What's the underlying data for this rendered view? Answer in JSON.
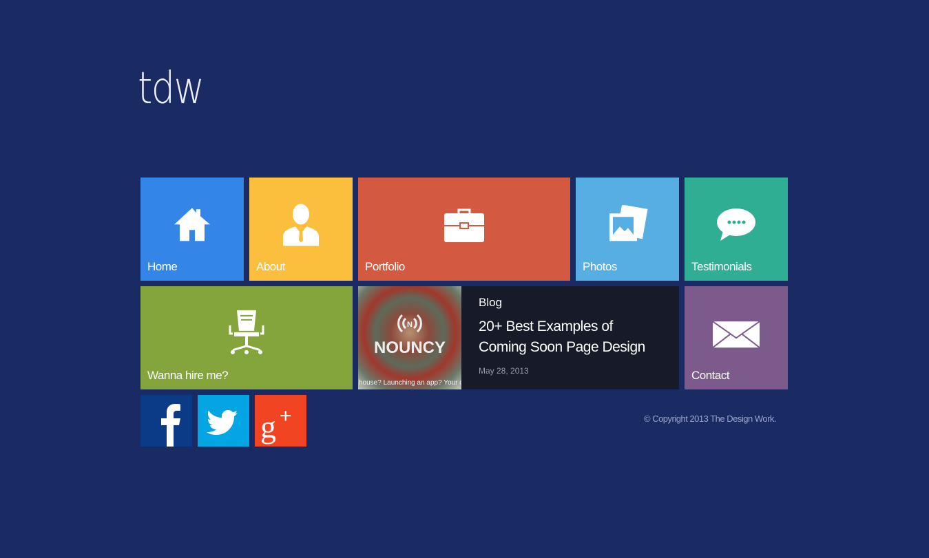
{
  "logo": "tdw",
  "tiles": {
    "home": "Home",
    "about": "About",
    "portfolio": "Portfolio",
    "photos": "Photos",
    "testimonials": "Testimonials",
    "hire": "Wanna hire me?",
    "contact": "Contact"
  },
  "blog": {
    "heading": "Blog",
    "title": "20+ Best Examples of Coming Soon Page Design",
    "date": "May 28, 2013",
    "image_brand": "NOUNCY",
    "image_caption": "house? Launching an app? Your dog"
  },
  "social": {
    "facebook": "f",
    "twitter": "twitter-bird",
    "googleplus": "g+"
  },
  "copyright": "© Copyright 2013 The Design Work.",
  "colors": {
    "background": "#1a2a63",
    "home": "#3386e8",
    "about": "#fbbe3d",
    "portfolio": "#d35940",
    "photos": "#57aee3",
    "testimonials": "#30ae94",
    "hire": "#84a43c",
    "contact": "#7d5a8c",
    "facebook": "#0b3b86",
    "twitter": "#03a6e2",
    "googleplus": "#f04423"
  }
}
